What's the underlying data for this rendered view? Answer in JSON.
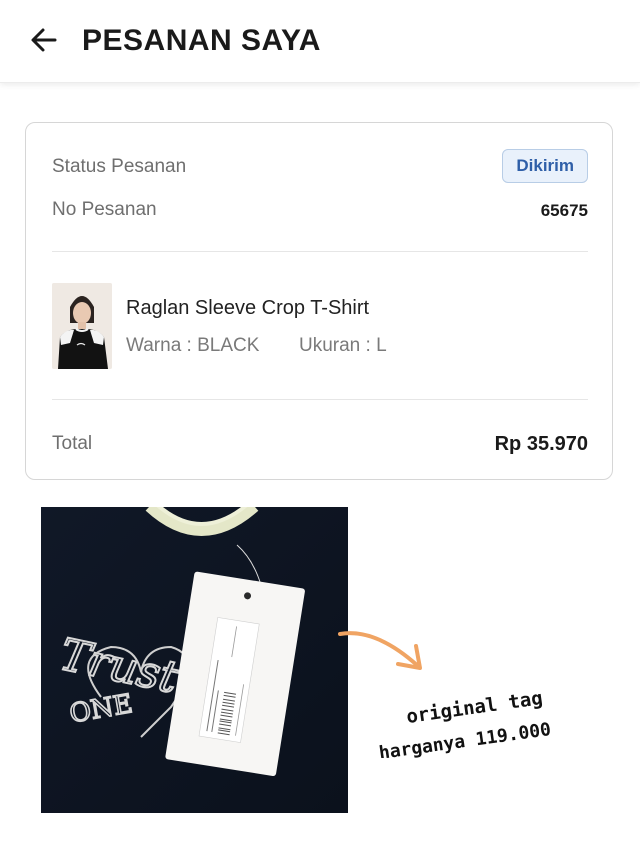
{
  "header": {
    "back_icon": "arrow-left-icon",
    "title": "PESANAN SAYA"
  },
  "order": {
    "status_label": "Status Pesanan",
    "status_value": "Dikirim",
    "order_no_label": "No Pesanan",
    "order_no_value": "65675",
    "product": {
      "name": "Raglan Sleeve Crop T-Shirt",
      "color": "Warna : BLACK",
      "size": "Ukuran : L"
    },
    "total_label": "Total",
    "total_value": "Rp 35.970"
  },
  "photo": {
    "print_text_1": "Trust",
    "print_text_2": "ONE"
  },
  "annotation": {
    "line1": "original tag",
    "line2": "harganya 119.000"
  },
  "colors": {
    "badge_bg": "#e9f1fb",
    "badge_text": "#2f5fa8",
    "arrow": "#f0a463"
  }
}
